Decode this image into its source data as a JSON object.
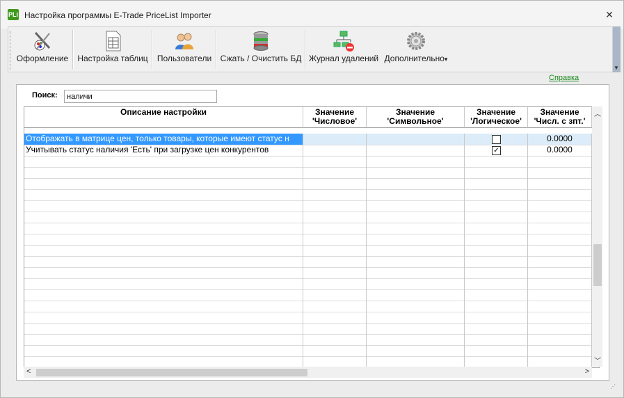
{
  "window": {
    "title": "Настройка программы E-Trade PriceList Importer",
    "icon_text": "PLi",
    "close": "✕"
  },
  "toolbar": {
    "buttons": [
      {
        "label": "Оформление",
        "icon": "design-brush-icon"
      },
      {
        "label": "Настройка таблиц",
        "icon": "table-document-icon"
      },
      {
        "label": "Пользователи",
        "icon": "users-icon"
      },
      {
        "label": "Сжать / Очистить БД",
        "icon": "database-icon"
      },
      {
        "label": "Журнал удалений",
        "icon": "deletion-log-icon"
      },
      {
        "label": "Дополнительно",
        "icon": "gear-icon"
      }
    ],
    "dropdown_arrow": "▾",
    "scroll_arrow": "▼"
  },
  "help": {
    "label": "Справка"
  },
  "search": {
    "label": "Поиск:",
    "value": "наличи"
  },
  "grid": {
    "columns": [
      {
        "line1": "Описание настройки",
        "line2": ""
      },
      {
        "line1": "Значение",
        "line2": "'Числовое'"
      },
      {
        "line1": "Значение",
        "line2": "'Символьное'"
      },
      {
        "line1": "Значение",
        "line2": "'Логическое'"
      },
      {
        "line1": "Значение",
        "line2": "'Числ. с зпт.'"
      }
    ],
    "rows": [
      {
        "description": "Отображать в матрице цен, только товары, которые имеют статус н",
        "numeric": "",
        "symbolic": "",
        "logical": "",
        "decimal": "0.0000",
        "selected": true
      },
      {
        "description": "Учитывать статус наличия 'Есть' при загрузке цен конкурентов",
        "numeric": "",
        "symbolic": "",
        "logical": "✓",
        "decimal": "0.0000",
        "selected": false
      }
    ]
  },
  "colors": {
    "selection": "#3399ff",
    "selection_light": "#dcecf9",
    "link": "#1e8a1e",
    "app_icon": "#3f9a1e"
  }
}
